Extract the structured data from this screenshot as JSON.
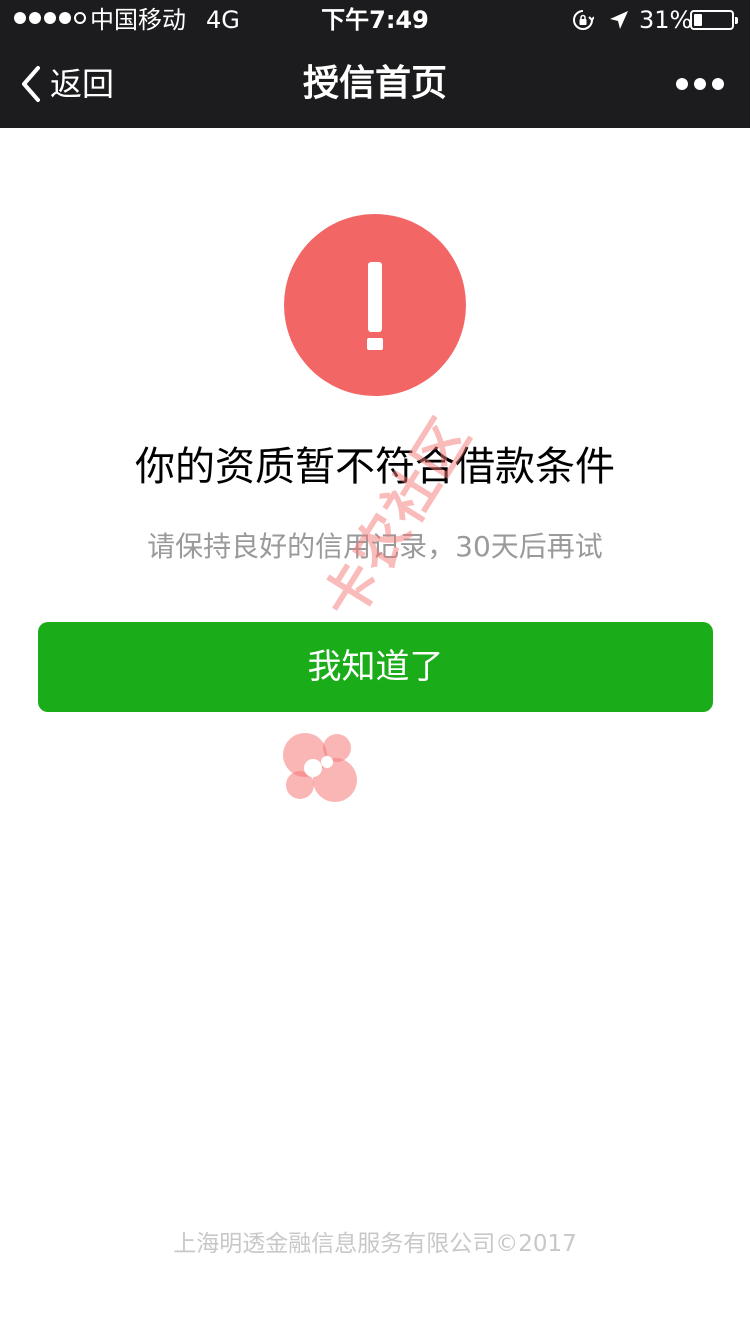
{
  "status_bar": {
    "carrier": "中国移动",
    "network": "4G",
    "time": "下午7:49",
    "battery_percent": "31%",
    "battery_level": 0.31,
    "icons": [
      "signal-dots",
      "orientation-lock-icon",
      "location-arrow-icon",
      "battery-icon"
    ]
  },
  "nav": {
    "back_label": "返回",
    "title": "授信首页",
    "more_icon": "more-dots-icon"
  },
  "content": {
    "icon": "exclamation-icon",
    "icon_color": "#f26666",
    "title": "你的资质暂不符合借款条件",
    "subtitle": "请保持良好的信用记录，30天后再试",
    "button_label": "我知道了",
    "button_color": "#1aad19"
  },
  "watermark": {
    "text": "卡农社区",
    "color": "#f67878"
  },
  "footer": {
    "text": "上海明透金融信息服务有限公司©2017"
  }
}
